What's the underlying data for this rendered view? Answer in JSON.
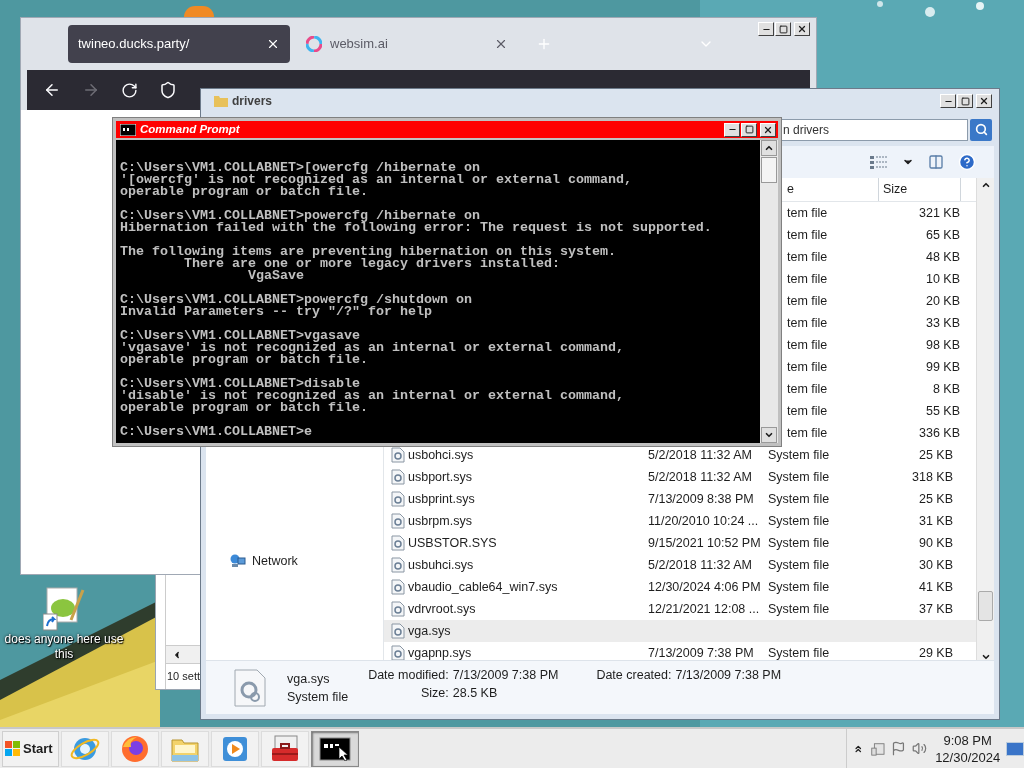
{
  "desktop": {
    "icons": [
      {
        "label": "does anyone here use this"
      }
    ]
  },
  "browser": {
    "tabs": [
      {
        "title": "twineo.ducks.party/",
        "selected": true
      },
      {
        "title": "websim.ai",
        "selected": false
      }
    ]
  },
  "behind_window": {
    "status": "10 sett"
  },
  "explorer": {
    "title": "drivers",
    "search": {
      "placeholder": "n drivers"
    },
    "columns": [
      {
        "label": "e"
      },
      {
        "label": "Size"
      }
    ],
    "nav": [
      {
        "label": "Network"
      }
    ],
    "rows": [
      {
        "kind": "partial",
        "type": "tem file",
        "size": "321 KB",
        "selected": false
      },
      {
        "kind": "partial",
        "type": "tem file",
        "size": "65 KB",
        "selected": false
      },
      {
        "kind": "partial",
        "type": "tem file",
        "size": "48 KB",
        "selected": false
      },
      {
        "kind": "partial",
        "type": "tem file",
        "size": "10 KB",
        "selected": false
      },
      {
        "kind": "partial",
        "type": "tem file",
        "size": "20 KB",
        "selected": false
      },
      {
        "kind": "partial",
        "type": "tem file",
        "size": "33 KB",
        "selected": false
      },
      {
        "kind": "partial",
        "type": "tem file",
        "size": "98 KB",
        "selected": false
      },
      {
        "kind": "partial",
        "type": "tem file",
        "size": "99 KB",
        "selected": false
      },
      {
        "kind": "partial",
        "type": "tem file",
        "size": "8 KB",
        "selected": false
      },
      {
        "kind": "partial",
        "type": "tem file",
        "size": "55 KB",
        "selected": false
      },
      {
        "kind": "partial",
        "type": "tem file",
        "size": "336 KB",
        "selected": false
      },
      {
        "kind": "file",
        "name": "usbohci.sys",
        "modified": "5/2/2018 11:32 AM",
        "type": "System file",
        "size": "25 KB",
        "selected": false
      },
      {
        "kind": "file",
        "name": "usbport.sys",
        "modified": "5/2/2018 11:32 AM",
        "type": "System file",
        "size": "318 KB",
        "selected": false
      },
      {
        "kind": "file",
        "name": "usbprint.sys",
        "modified": "7/13/2009 8:38 PM",
        "type": "System file",
        "size": "25 KB",
        "selected": false
      },
      {
        "kind": "file",
        "name": "usbrpm.sys",
        "modified": "11/20/2010 10:24 ...",
        "type": "System file",
        "size": "31 KB",
        "selected": false
      },
      {
        "kind": "file",
        "name": "USBSTOR.SYS",
        "modified": "9/15/2021 10:52 PM",
        "type": "System file",
        "size": "90 KB",
        "selected": false
      },
      {
        "kind": "file",
        "name": "usbuhci.sys",
        "modified": "5/2/2018 11:32 AM",
        "type": "System file",
        "size": "30 KB",
        "selected": false
      },
      {
        "kind": "file",
        "name": "vbaudio_cable64_win7.sys",
        "modified": "12/30/2024 4:06 PM",
        "type": "System file",
        "size": "41 KB",
        "selected": false
      },
      {
        "kind": "file",
        "name": "vdrvroot.sys",
        "modified": "12/21/2021 12:08 ...",
        "type": "System file",
        "size": "37 KB",
        "selected": false
      },
      {
        "kind": "file",
        "name": "vga.sys",
        "selected": true
      },
      {
        "kind": "file",
        "name": "vgapnp.sys",
        "modified": "7/13/2009 7:38 PM",
        "type": "System file",
        "size": "29 KB",
        "selected": false
      }
    ],
    "details": {
      "name": "vga.sys",
      "type": "System file",
      "fields": [
        {
          "label": "Date modified:",
          "value": "7/13/2009 7:38 PM"
        },
        {
          "label": "Size:",
          "value": "28.5 KB"
        },
        {
          "label": "Date created:",
          "value": "7/13/2009 7:38 PM"
        }
      ]
    }
  },
  "cmd": {
    "title": "Command Prompt",
    "output": "C:\\Users\\VM1.COLLABNET>[owercfg /hibernate on\n'[owercfg' is not recognized as an internal or external command,\noperable program or batch file.\n\nC:\\Users\\VM1.COLLABNET>powercfg /hibernate on\nHibernation failed with the following error: The request is not supported.\n\nThe following items are preventing hibernation on this system.\n        There are one or more legacy drivers installed:\n                VgaSave\n\nC:\\Users\\VM1.COLLABNET>powercfg /shutdown on\nInvalid Parameters -- try \"/?\" for help\n\nC:\\Users\\VM1.COLLABNET>vgasave\n'vgasave' is not recognized as an internal or external command,\noperable program or batch file.\n\nC:\\Users\\VM1.COLLABNET>disable\n'disable' is not recognized as an internal or external command,\noperable program or batch file.\n\nC:\\Users\\VM1.COLLABNET>e"
  },
  "taskbar": {
    "start": "Start",
    "apps": [
      {
        "kind": "ie",
        "active": false
      },
      {
        "kind": "firefox",
        "active": false
      },
      {
        "kind": "explorer",
        "active": false
      },
      {
        "kind": "media",
        "active": false
      },
      {
        "kind": "toolbox",
        "active": false
      },
      {
        "kind": "cmd",
        "active": true
      }
    ],
    "clock": {
      "time": "9:08 PM",
      "date": "12/30/2024"
    }
  }
}
